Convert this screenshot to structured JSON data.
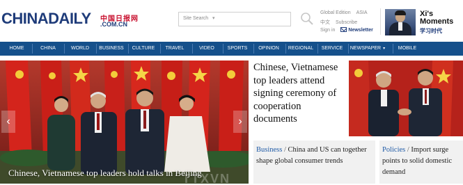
{
  "header": {
    "logo_china": "CHINA",
    "logo_daily": "DAILY",
    "logo_cn": "中国日报网",
    "logo_domain": ".COM.CN",
    "search": {
      "placeholder": "Site Search",
      "caret": "▾"
    },
    "utility": {
      "global_edition": "Global Edition",
      "asia": "ASIA",
      "chinese": "中文",
      "subscribe": "Subscribe",
      "sign_in": "Sign in",
      "newsletter": "Newsletter"
    },
    "xi_promo": {
      "title_line1": "Xi's",
      "title_line2": "Moments",
      "cn": "学习时代"
    }
  },
  "nav": {
    "items": [
      "HOME",
      "CHINA",
      "WORLD",
      "BUSINESS",
      "CULTURE",
      "TRAVEL",
      "VIDEO",
      "SPORTS",
      "OPINION",
      "REGIONAL",
      "SERVICE",
      "NEWSPAPER",
      "MOBILE"
    ],
    "newspaper_caret": "▾"
  },
  "hero": {
    "caption": "Chinese, Vietnamese top leaders hold talks in Beijing",
    "prev": "‹",
    "next": "›",
    "watermark": "TTXVN"
  },
  "top_story": {
    "headline": "Chinese, Vietnamese top leaders attend signing ceremony of cooperation documents"
  },
  "sub_stories": [
    {
      "tag": "Business",
      "separator": "/",
      "headline": "China and US can together shape global consumer trends"
    },
    {
      "tag": "Policies",
      "separator": "/",
      "headline": "Import surge points to solid domestic demand"
    }
  ],
  "colors": {
    "brand_blue": "#1f3c7a",
    "nav_blue": "#15508b",
    "tag_blue": "#1f5aa6",
    "flag_red": "#c8102e"
  }
}
